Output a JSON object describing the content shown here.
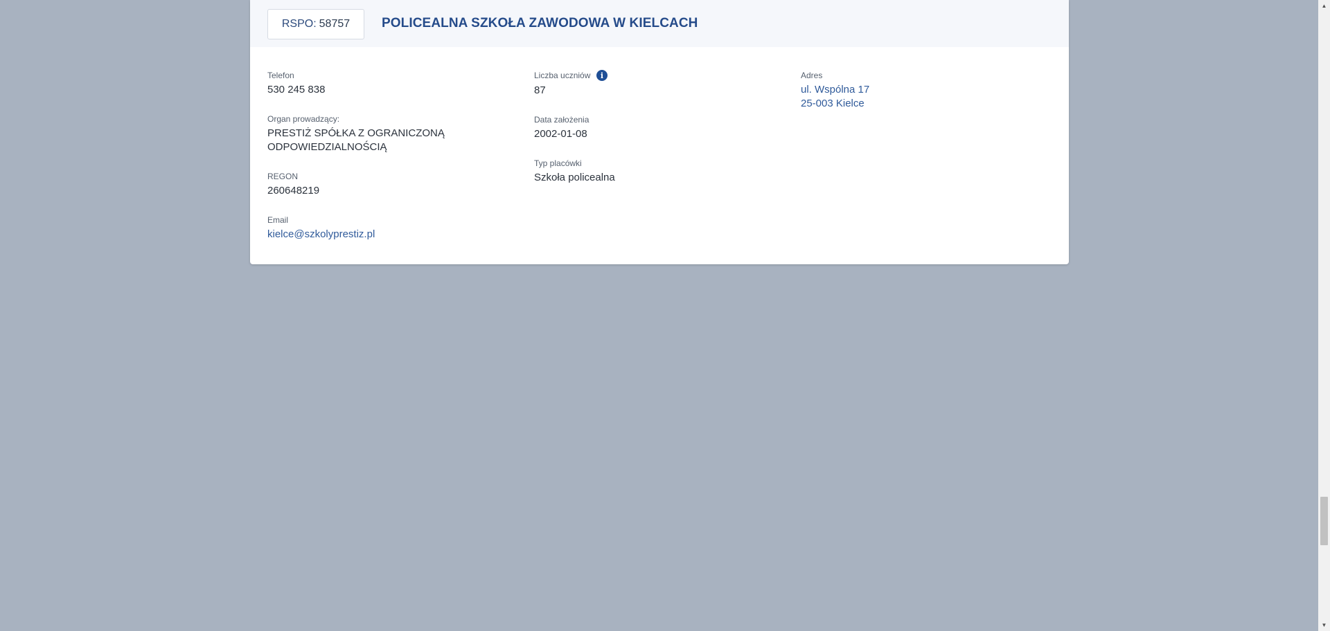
{
  "school": {
    "rspo_prefix": "RSPO:",
    "rspo_number": "58757",
    "name": "POLICEALNA SZKOŁA ZAWODOWA W KIELCACH"
  },
  "fields": {
    "phone": {
      "label": "Telefon",
      "value": "530 245 838"
    },
    "organ": {
      "label": "Organ prowadzący:",
      "value_line1": "PRESTIŻ SPÓŁKA Z OGRANICZONĄ",
      "value_line2": "ODPOWIEDZIALNOŚCIĄ"
    },
    "regon": {
      "label": "REGON",
      "value": "260648219"
    },
    "email": {
      "label": "Email",
      "value": "kielce@szkolyprestiz.pl"
    },
    "students": {
      "label": "Liczba uczniów",
      "value": "87",
      "info_icon": "info-icon",
      "info_glyph": "i"
    },
    "founded": {
      "label": "Data założenia",
      "value": "2002-01-08"
    },
    "type": {
      "label": "Typ placówki",
      "value": "Szkoła policealna"
    },
    "address": {
      "label": "Adres",
      "line1": "ul. Wspólna 17",
      "line2": "25-003 Kielce"
    }
  },
  "scrollbar": {
    "up_arrow": "▲",
    "down_arrow": "▼"
  },
  "colors": {
    "background": "#a8b2c0",
    "accent": "#254b8a",
    "link": "#2f5a9a",
    "header_bg": "#f5f7fb"
  }
}
